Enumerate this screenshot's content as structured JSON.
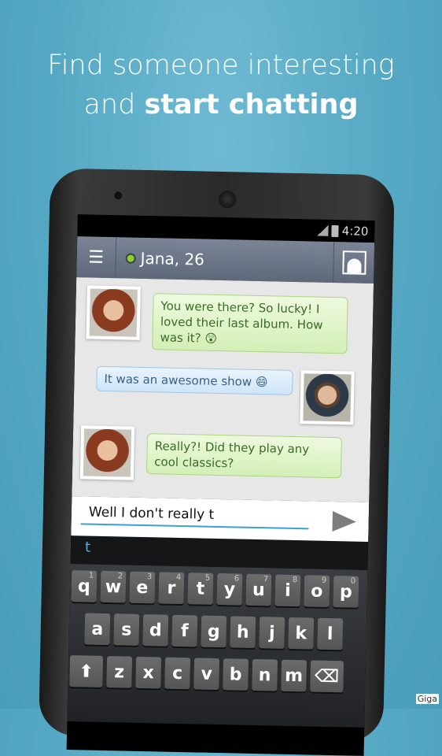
{
  "headline": {
    "line1": "Find someone interesting",
    "line2_prefix": "and ",
    "line2_bold": "start chatting"
  },
  "status_bar": {
    "time": "4:20",
    "icons": [
      "signal-icon",
      "battery-icon"
    ]
  },
  "header": {
    "contact_name": "Jana, 26",
    "online_color": "#8fd12a",
    "menu_icon": "hamburger-icon",
    "profile_icon": "profile-icon"
  },
  "messages": [
    {
      "from": "them",
      "text": "You were there? So lucky! I loved their last album. How was it? 😲"
    },
    {
      "from": "me",
      "text": "It was an awesome show 😄"
    },
    {
      "from": "them",
      "text": "Really?! Did they play any cool classics?"
    }
  ],
  "composer": {
    "value": "Well I don't really t",
    "send_icon": "send-icon"
  },
  "suggestion": "t",
  "keyboard": {
    "row1": [
      [
        "q",
        "1"
      ],
      [
        "w",
        "2"
      ],
      [
        "e",
        "3"
      ],
      [
        "r",
        "4"
      ],
      [
        "t",
        "5"
      ],
      [
        "y",
        "6"
      ],
      [
        "u",
        "7"
      ],
      [
        "i",
        "8"
      ],
      [
        "o",
        "9"
      ],
      [
        "p",
        "0"
      ]
    ],
    "row2": [
      "a",
      "s",
      "d",
      "f",
      "g",
      "h",
      "j",
      "k",
      "l"
    ],
    "row3": [
      "z",
      "x",
      "c",
      "v",
      "b",
      "n",
      "m"
    ],
    "shift": "⬆",
    "backspace": "⌫"
  },
  "watermark": "Giga"
}
